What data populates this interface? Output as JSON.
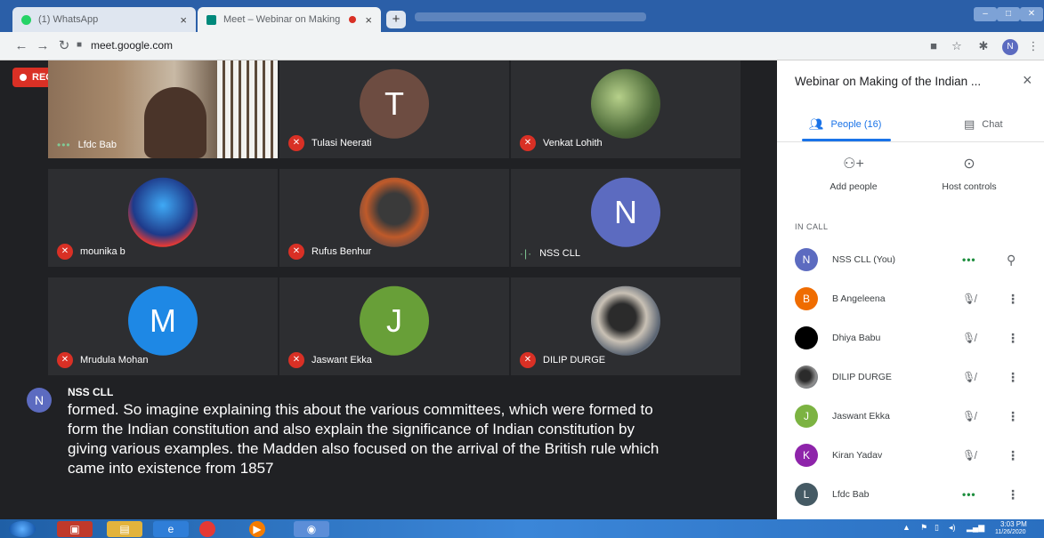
{
  "browser": {
    "tabs": [
      {
        "label": "(1) WhatsApp"
      },
      {
        "label": "Meet – Webinar on Making"
      }
    ],
    "new_tab": "+",
    "close_glyph": "×",
    "url": "meet.google.com",
    "profile_initial": "N",
    "colors": {
      "tabbar": "#2b5fa8",
      "accent": "#1a73e8"
    }
  },
  "meeting": {
    "rec_label": "REC",
    "tiles": [
      {
        "name": "Lfdc Bab",
        "initial": "",
        "color": "",
        "status": "speaking"
      },
      {
        "name": "Tulasi Neerati",
        "initial": "T",
        "color": "#6d4c41",
        "status": "muted"
      },
      {
        "name": "Venkat Lohith",
        "initial": "",
        "color": "#4e6b3a",
        "status": "muted"
      },
      {
        "name": "mounika b",
        "initial": "",
        "color": "#1e3a8a",
        "status": "muted"
      },
      {
        "name": "Rufus Benhur",
        "initial": "",
        "color": "#bf5a2a",
        "status": "muted"
      },
      {
        "name": "NSS CLL",
        "initial": "N",
        "color": "#5c6bc0",
        "status": "speaking"
      },
      {
        "name": "Mrudula Mohan",
        "initial": "M",
        "color": "#1e88e5",
        "status": "muted"
      },
      {
        "name": "Jaswant Ekka",
        "initial": "J",
        "color": "#689f38",
        "status": "muted"
      },
      {
        "name": "DILIP DURGE",
        "initial": "",
        "color": "#5a6472",
        "status": "muted"
      }
    ],
    "caption": {
      "initial": "N",
      "speaker": "NSS CLL",
      "text": "formed. So imagine explaining this about the various committees, which were formed to form the Indian constitution and also explain the significance of Indian constitution by giving various examples. the Madden also focused on the arrival of the British rule which came into existence from 1857"
    }
  },
  "panel": {
    "title": "Webinar on Making of the Indian ...",
    "close": "×",
    "tabs": {
      "people": "People (16)",
      "chat": "Chat"
    },
    "actions": {
      "add_people": "Add people",
      "host_controls": "Host controls"
    },
    "section_label": "IN CALL",
    "participants": [
      {
        "name": "NSS CLL (You)",
        "initial": "N",
        "color": "#5c6bc0",
        "status": "speaking",
        "extra": "pin"
      },
      {
        "name": "B Angeleena",
        "initial": "B",
        "color": "#ef6c00",
        "status": "muted",
        "extra": "more"
      },
      {
        "name": "Dhiya Babu",
        "initial": "",
        "color": "#000000",
        "status": "muted",
        "extra": "more"
      },
      {
        "name": "DILIP DURGE",
        "initial": "",
        "color": "#5a6472",
        "status": "muted",
        "extra": "more"
      },
      {
        "name": "Jaswant Ekka",
        "initial": "J",
        "color": "#7cb342",
        "status": "muted",
        "extra": "more"
      },
      {
        "name": "Kiran Yadav",
        "initial": "K",
        "color": "#8e24aa",
        "status": "muted",
        "extra": "more"
      },
      {
        "name": "Lfdc Bab",
        "initial": "L",
        "color": "#455a64",
        "status": "speaking",
        "extra": "more"
      }
    ]
  },
  "taskbar": {
    "time": "3:03 PM",
    "date": "11/26/2020"
  }
}
